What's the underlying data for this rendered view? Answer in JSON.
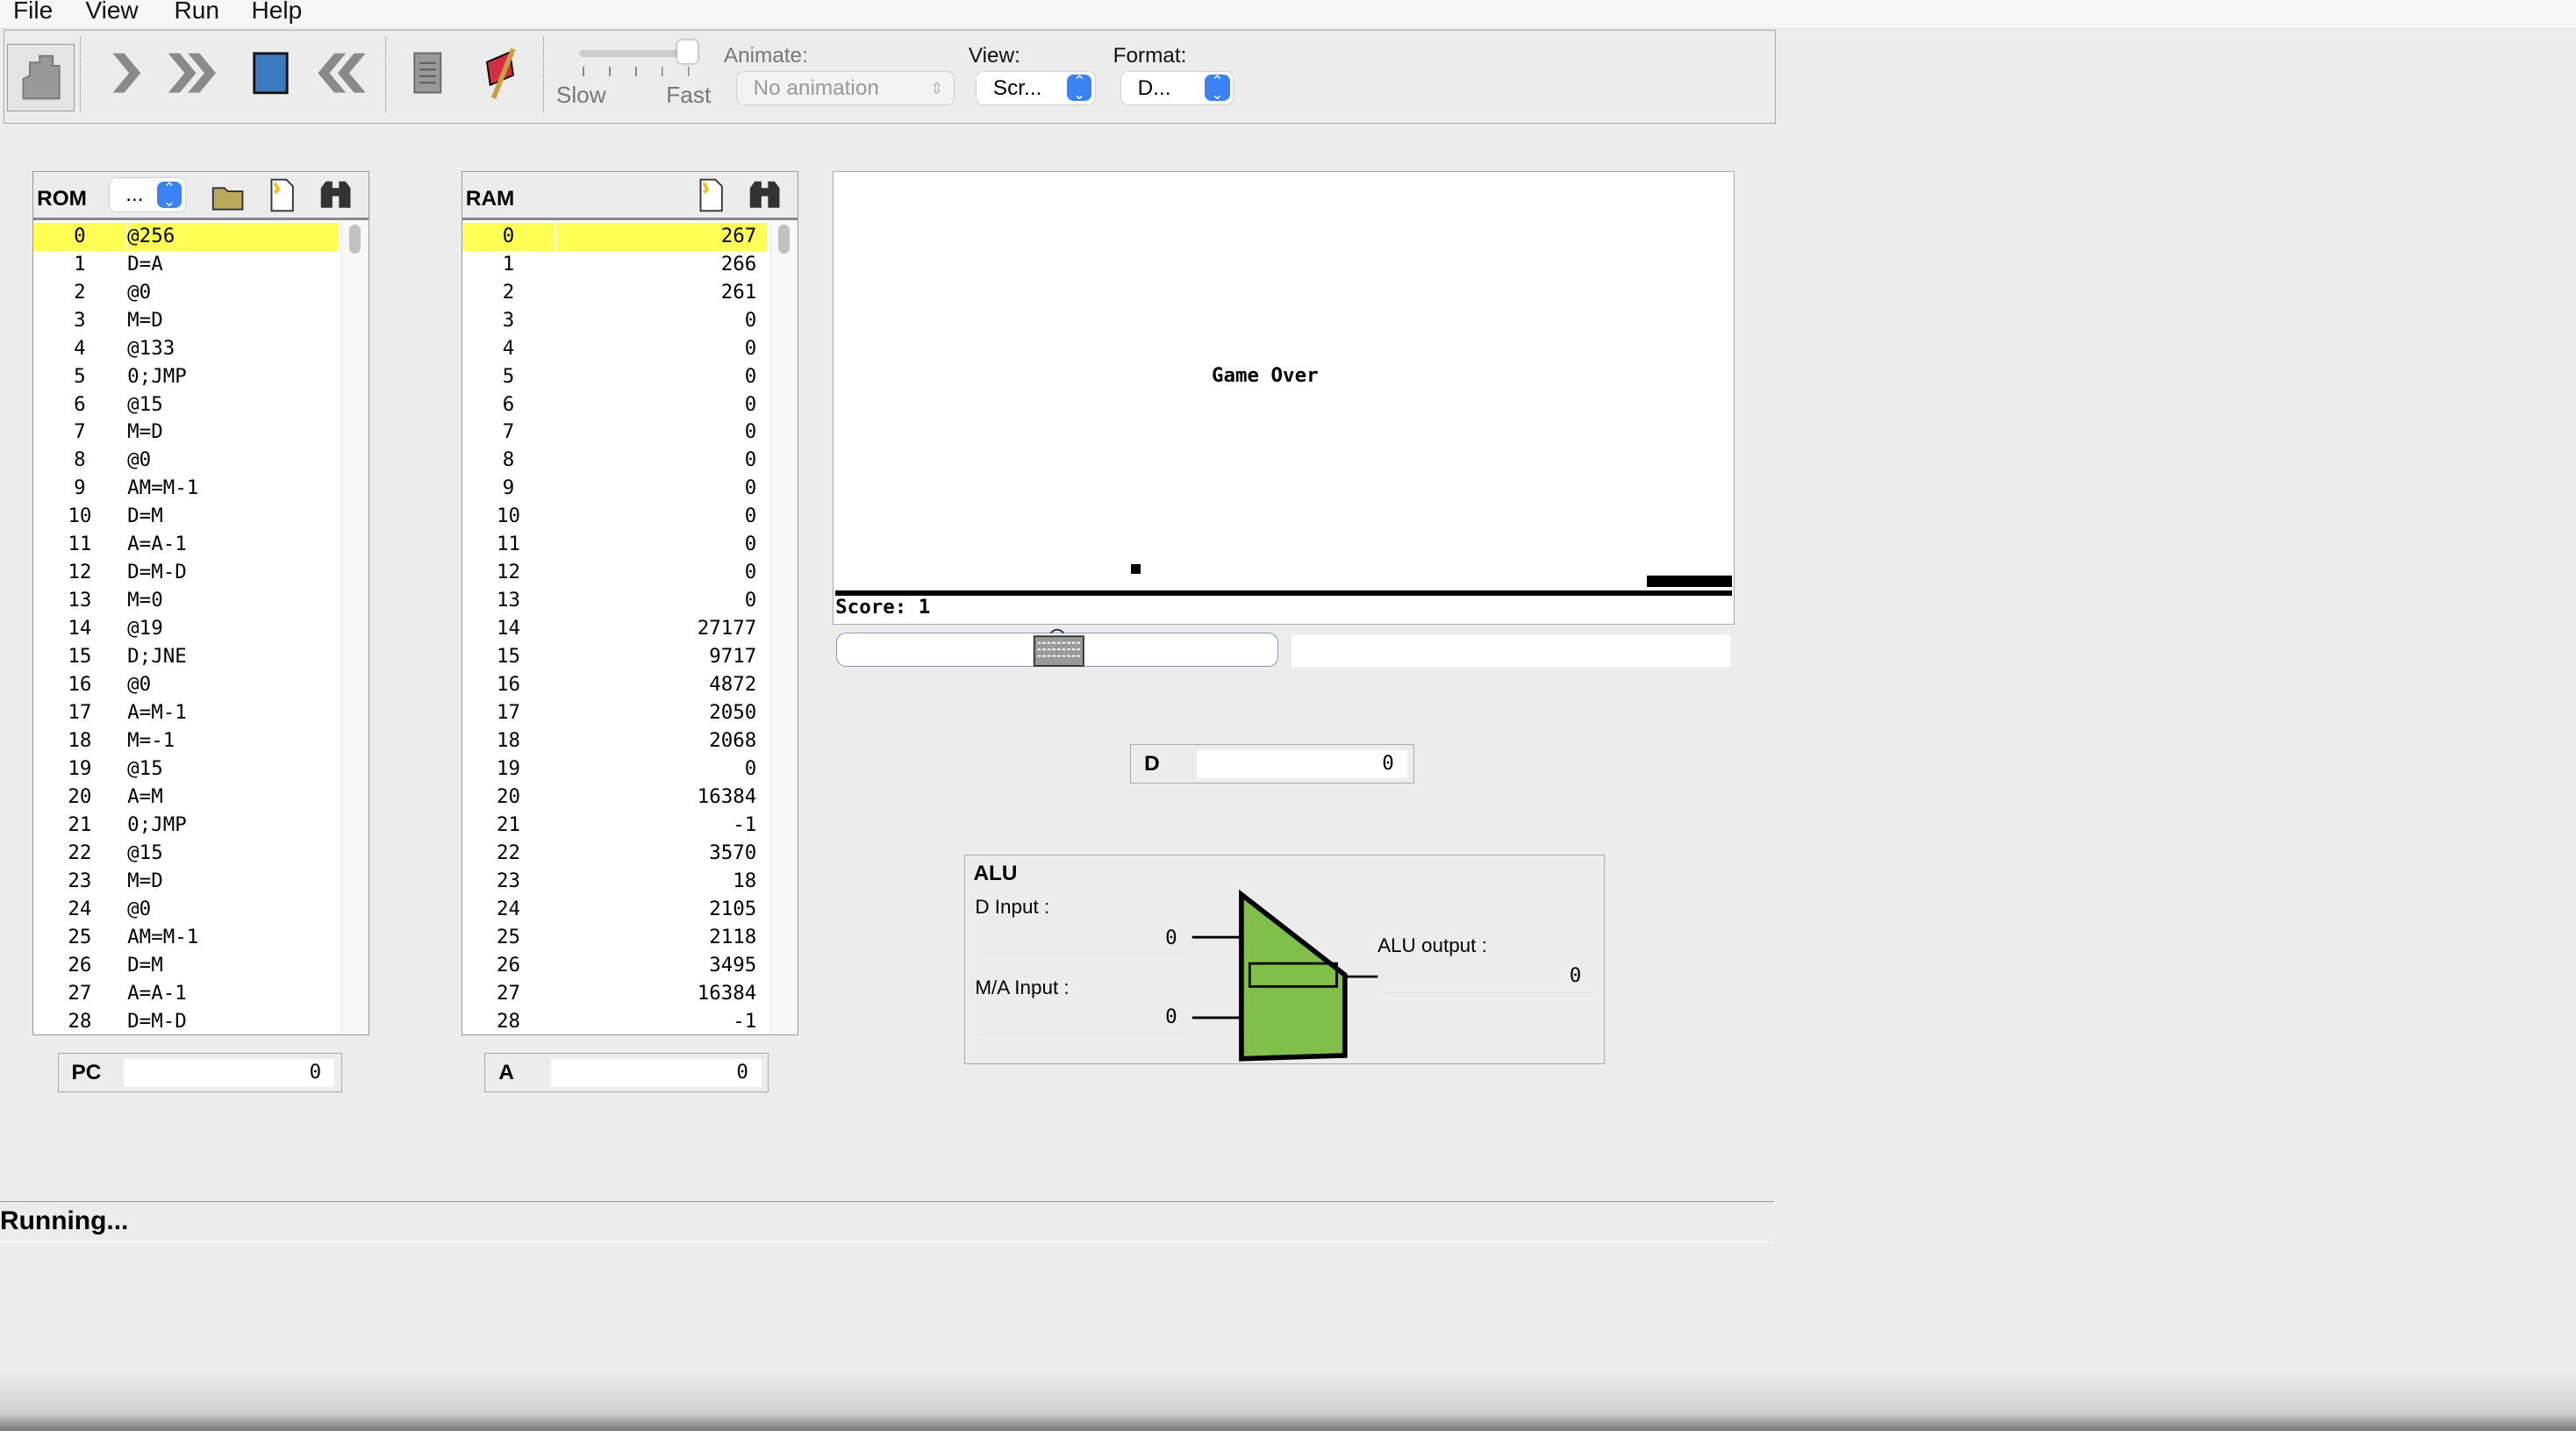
{
  "menu": [
    "File",
    "View",
    "Run",
    "Help"
  ],
  "toolbar": {
    "animate_label": "Animate:",
    "animate_value": "No animation",
    "view_label": "View:",
    "view_value": "Scr...",
    "format_label": "Format:",
    "format_value": "D...",
    "slow": "Slow",
    "fast": "Fast",
    "speed_fraction": 1.0
  },
  "rom": {
    "title": "ROM",
    "combo": "...",
    "selected": 0,
    "rows": [
      [
        "0",
        "@256"
      ],
      [
        "1",
        "D=A"
      ],
      [
        "2",
        "@0"
      ],
      [
        "3",
        "M=D"
      ],
      [
        "4",
        "@133"
      ],
      [
        "5",
        "0;JMP"
      ],
      [
        "6",
        "@15"
      ],
      [
        "7",
        "M=D"
      ],
      [
        "8",
        "@0"
      ],
      [
        "9",
        "AM=M-1"
      ],
      [
        "10",
        "D=M"
      ],
      [
        "11",
        "A=A-1"
      ],
      [
        "12",
        "D=M-D"
      ],
      [
        "13",
        "M=0"
      ],
      [
        "14",
        "@19"
      ],
      [
        "15",
        "D;JNE"
      ],
      [
        "16",
        "@0"
      ],
      [
        "17",
        "A=M-1"
      ],
      [
        "18",
        "M=-1"
      ],
      [
        "19",
        "@15"
      ],
      [
        "20",
        "A=M"
      ],
      [
        "21",
        "0;JMP"
      ],
      [
        "22",
        "@15"
      ],
      [
        "23",
        "M=D"
      ],
      [
        "24",
        "@0"
      ],
      [
        "25",
        "AM=M-1"
      ],
      [
        "26",
        "D=M"
      ],
      [
        "27",
        "A=A-1"
      ],
      [
        "28",
        "D=M-D"
      ]
    ]
  },
  "ram": {
    "title": "RAM",
    "selected": 0,
    "rows": [
      [
        "0",
        "267"
      ],
      [
        "1",
        "266"
      ],
      [
        "2",
        "261"
      ],
      [
        "3",
        "0"
      ],
      [
        "4",
        "0"
      ],
      [
        "5",
        "0"
      ],
      [
        "6",
        "0"
      ],
      [
        "7",
        "0"
      ],
      [
        "8",
        "0"
      ],
      [
        "9",
        "0"
      ],
      [
        "10",
        "0"
      ],
      [
        "11",
        "0"
      ],
      [
        "12",
        "0"
      ],
      [
        "13",
        "0"
      ],
      [
        "14",
        "27177"
      ],
      [
        "15",
        "9717"
      ],
      [
        "16",
        "4872"
      ],
      [
        "17",
        "2050"
      ],
      [
        "18",
        "2068"
      ],
      [
        "19",
        "0"
      ],
      [
        "20",
        "16384"
      ],
      [
        "21",
        "-1"
      ],
      [
        "22",
        "3570"
      ],
      [
        "23",
        "18"
      ],
      [
        "24",
        "2105"
      ],
      [
        "25",
        "2118"
      ],
      [
        "26",
        "3495"
      ],
      [
        "27",
        "16384"
      ],
      [
        "28",
        "-1"
      ]
    ]
  },
  "pc": {
    "label": "PC",
    "value": "0"
  },
  "a": {
    "label": "A",
    "value": "0"
  },
  "d": {
    "label": "D",
    "value": "0"
  },
  "screen": {
    "message": "Game Over",
    "score": "Score: 1"
  },
  "alu": {
    "title": "ALU",
    "d_input_label": "D Input :",
    "d_input": "0",
    "ma_input_label": "M/A Input :",
    "ma_input": "0",
    "output_label": "ALU output :",
    "output": "0",
    "color": "#80c04a"
  },
  "status": "Running..."
}
